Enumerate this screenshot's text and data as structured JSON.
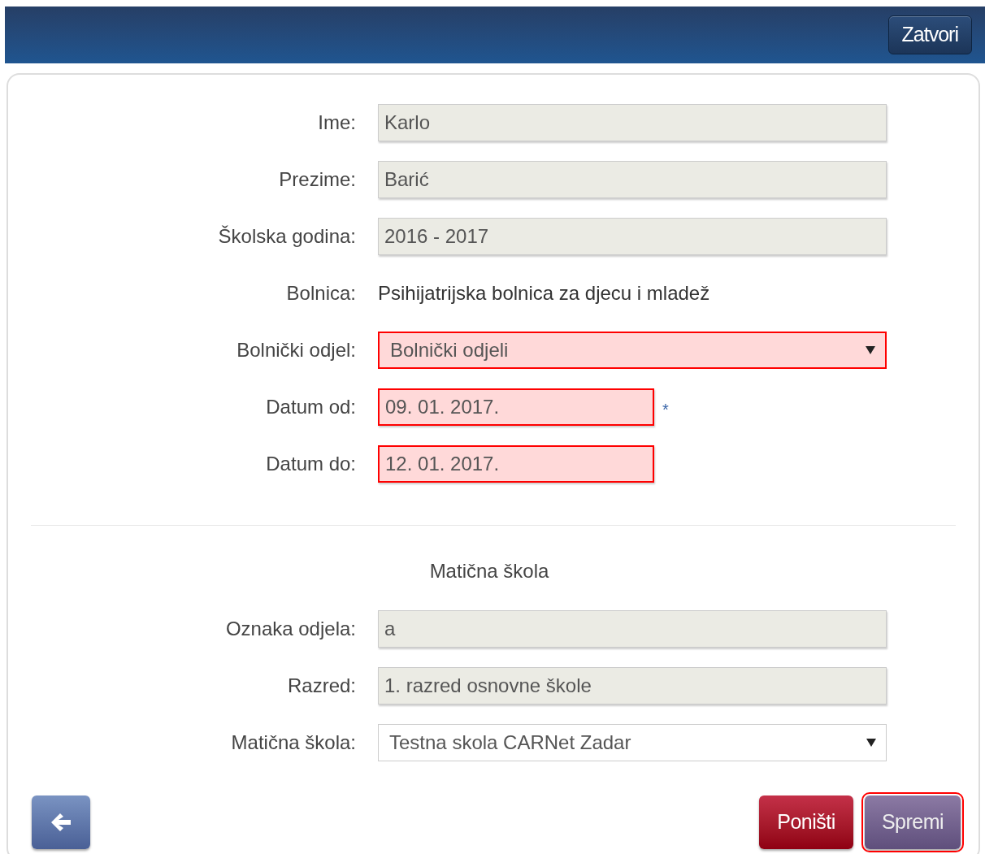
{
  "header": {
    "close_button": "Zatvori"
  },
  "fields": [
    {
      "label": "Ime:",
      "kind": "readonly",
      "value": "Karlo",
      "invalid": false
    },
    {
      "label": "Prezime:",
      "kind": "readonly",
      "value": "Barić",
      "invalid": false
    },
    {
      "label": "Školska godina:",
      "kind": "readonly",
      "value": "2016 - 2017",
      "invalid": false
    },
    {
      "label": "Bolnica:",
      "kind": "static",
      "value": "Psihijatrijska bolnica za djecu i mladež",
      "invalid": false
    },
    {
      "label": "Bolnički odjel:",
      "kind": "select",
      "value": "Bolnički odjeli",
      "invalid": true
    },
    {
      "label": "Datum od:",
      "kind": "date",
      "value": "09. 01. 2017.",
      "invalid": true,
      "required_mark": "*"
    },
    {
      "label": "Datum do:",
      "kind": "date",
      "value": "12. 01. 2017.",
      "invalid": true
    }
  ],
  "section_title": "Matična škola",
  "school_fields": [
    {
      "label": "Oznaka odjela:",
      "kind": "readonly",
      "value": "a",
      "invalid": false
    },
    {
      "label": "Razred:",
      "kind": "readonly",
      "value": "1. razred osnovne škole",
      "invalid": false
    },
    {
      "label": "Matična škola:",
      "kind": "select",
      "value": "Testna skola CARNet Zadar",
      "invalid": false
    }
  ],
  "buttons": [
    {
      "label": "Poništi",
      "kind": "cancel",
      "outlined": false
    },
    {
      "label": "Spremi",
      "kind": "save",
      "outlined": true
    }
  ]
}
